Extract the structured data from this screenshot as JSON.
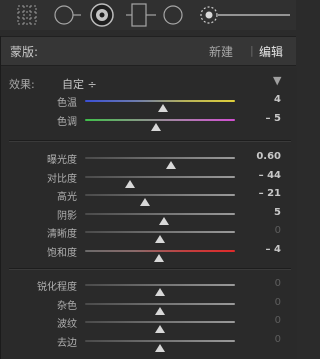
{
  "mask_panel": {
    "label": "蒙版:",
    "new_label": "新建",
    "separator": "|",
    "edit_label": "编辑"
  },
  "effect": {
    "label": "效果:",
    "value": "自定 ÷",
    "collapse_arrow": "▼"
  },
  "colors": {
    "temp_track": "blue-to-yellow",
    "tint_track": "green-to-magenta",
    "saturation_track": "gray-to-red"
  },
  "groups": [
    {
      "sliders": [
        {
          "label": "色温",
          "value": "4",
          "level": 0.52,
          "dim": false,
          "track": "temp"
        },
        {
          "label": "色调",
          "value": "– 5",
          "level": 0.475,
          "dim": false,
          "track": "tint"
        }
      ]
    },
    {
      "sliders": [
        {
          "label": "曝光度",
          "value": "0.60",
          "level": 0.575,
          "dim": false,
          "track": "neutral"
        },
        {
          "label": "对比度",
          "value": "– 44",
          "level": 0.3,
          "dim": false,
          "track": "neutral"
        },
        {
          "label": "高光",
          "value": "– 21",
          "level": 0.4,
          "dim": false,
          "track": "neutral"
        },
        {
          "label": "阴影",
          "value": "5",
          "level": 0.525,
          "dim": false,
          "track": "neutral"
        },
        {
          "label": "清晰度",
          "value": "0",
          "level": 0.5,
          "dim": true,
          "track": "neutral"
        },
        {
          "label": "饱和度",
          "value": "– 4",
          "level": 0.49,
          "dim": false,
          "track": "saturation"
        }
      ]
    },
    {
      "sliders": [
        {
          "label": "锐化程度",
          "value": "0",
          "level": 0.5,
          "dim": true,
          "track": "neutral"
        },
        {
          "label": "杂色",
          "value": "0",
          "level": 0.5,
          "dim": true,
          "track": "neutral"
        },
        {
          "label": "波纹",
          "value": "0",
          "level": 0.5,
          "dim": true,
          "track": "neutral"
        },
        {
          "label": "去边",
          "value": "0",
          "level": 0.5,
          "dim": true,
          "track": "neutral"
        }
      ]
    }
  ],
  "toolbar_icons": [
    "crop-overlay-icon",
    "spot-removal-icon",
    "red-eye-icon",
    "graduated-filter-icon",
    "radial-filter-icon",
    "adjustment-brush-icon"
  ]
}
